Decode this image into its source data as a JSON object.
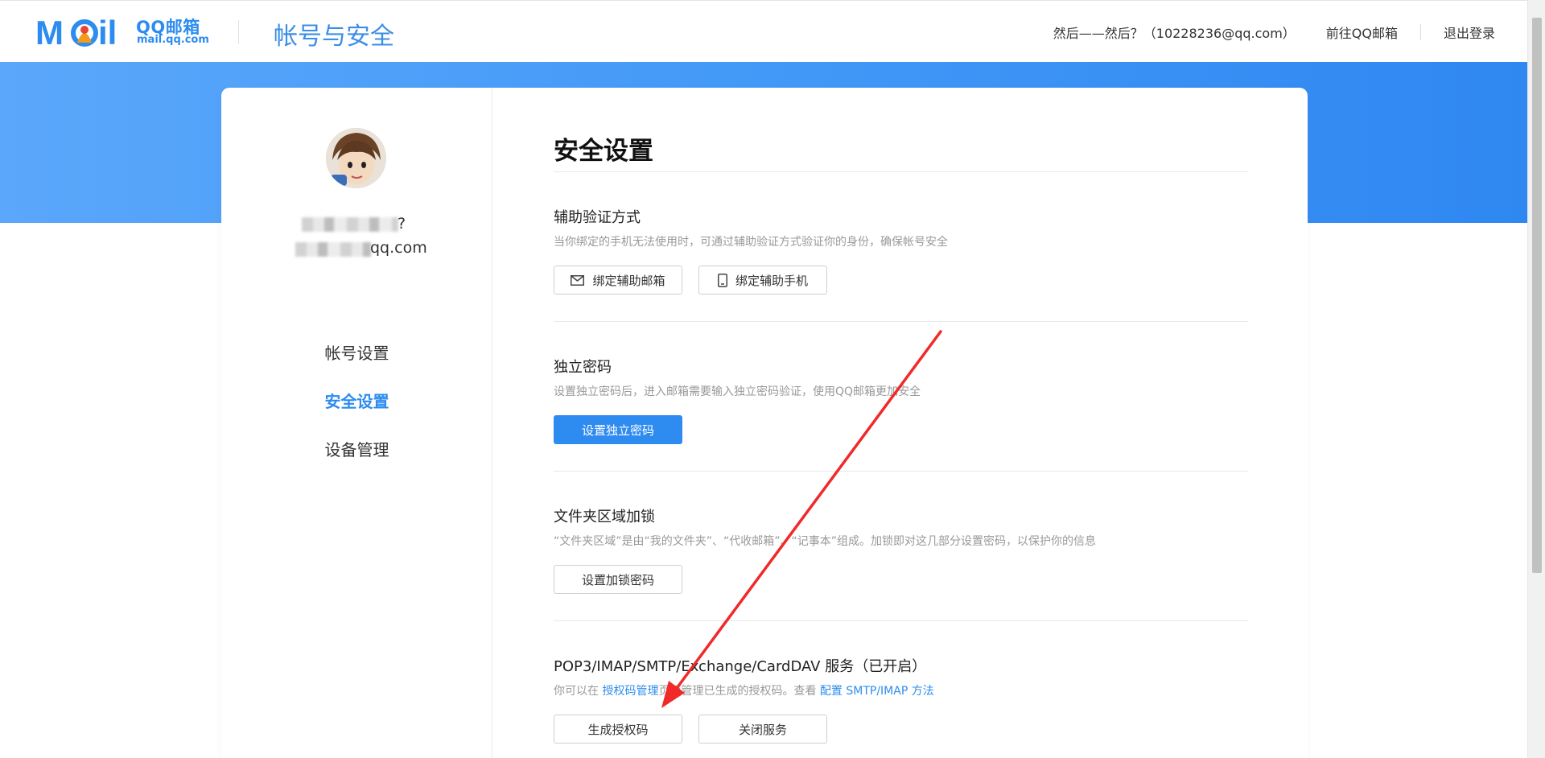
{
  "header": {
    "logo_qq": "QQ邮箱",
    "logo_domain": "mail.qq.com",
    "title": "帐号与安全",
    "user": "然后——然后？（10228236@qq.com）",
    "goto_mail": "前往QQ邮箱",
    "logout": "退出登录"
  },
  "sidebar": {
    "nickname_suffix": "?",
    "email_suffix": "qq.com",
    "items": [
      {
        "label": "帐号设置"
      },
      {
        "label": "安全设置"
      },
      {
        "label": "设备管理"
      }
    ]
  },
  "main": {
    "title": "安全设置",
    "sections": [
      {
        "title": "辅助验证方式",
        "desc": "当你绑定的手机无法使用时，可通过辅助验证方式验证你的身份，确保帐号安全",
        "buttons": [
          "绑定辅助邮箱",
          "绑定辅助手机"
        ]
      },
      {
        "title": "独立密码",
        "desc": "设置独立密码后，进入邮箱需要输入独立密码验证，使用QQ邮箱更加安全",
        "buttons": [
          "设置独立密码"
        ]
      },
      {
        "title": "文件夹区域加锁",
        "desc": "“文件夹区域”是由“我的文件夹”、“代收邮箱”、“记事本”组成。加锁即对这几部分设置密码，以保护你的信息",
        "buttons": [
          "设置加锁密码"
        ]
      },
      {
        "title": "POP3/IMAP/SMTP/Exchange/CardDAV 服务（已开启）",
        "desc_prefix": "你可以在",
        "desc_link1": "授权码管理",
        "desc_middle": "页面管理已生成的授权码。查看",
        "desc_link2": "配置 SMTP/IMAP 方法",
        "buttons": [
          "生成授权码",
          "关闭服务"
        ]
      }
    ]
  },
  "colors": {
    "accent": "#2c8cf0",
    "band_left": "#5aa7fb",
    "band_right": "#2f87f1",
    "annotation": "#f02a2a"
  },
  "icons": [
    "mail-icon",
    "phone-icon",
    "avatar-image",
    "red-arrow-annotation"
  ]
}
